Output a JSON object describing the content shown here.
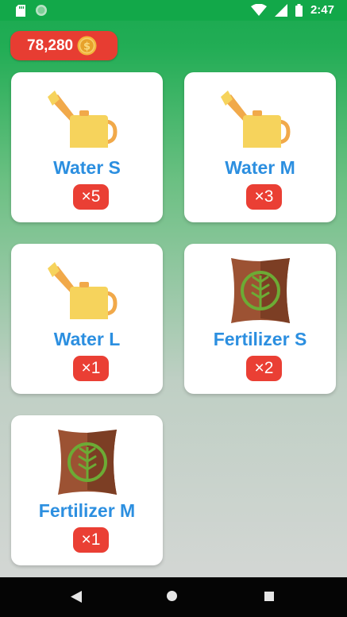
{
  "status_bar": {
    "time": "2:47"
  },
  "wallet": {
    "coins": "78,280",
    "coin_icon": "gold-dollar-coin"
  },
  "inventory": [
    {
      "name": "Water S",
      "qty": "×5",
      "icon": "watering-can"
    },
    {
      "name": "Water M",
      "qty": "×3",
      "icon": "watering-can"
    },
    {
      "name": "Water L",
      "qty": "×1",
      "icon": "watering-can"
    },
    {
      "name": "Fertilizer S",
      "qty": "×2",
      "icon": "fertilizer-sack"
    },
    {
      "name": "Fertilizer M",
      "qty": "×1",
      "icon": "fertilizer-sack"
    }
  ],
  "colors": {
    "accent_blue": "#2c8fe0",
    "badge_red": "#ea3f34",
    "status_green": "#12a849",
    "can_yellow": "#f6d35c",
    "can_orange": "#f1a94a",
    "sack_brown": "#9c5233",
    "leaf_green": "#6cab35"
  }
}
